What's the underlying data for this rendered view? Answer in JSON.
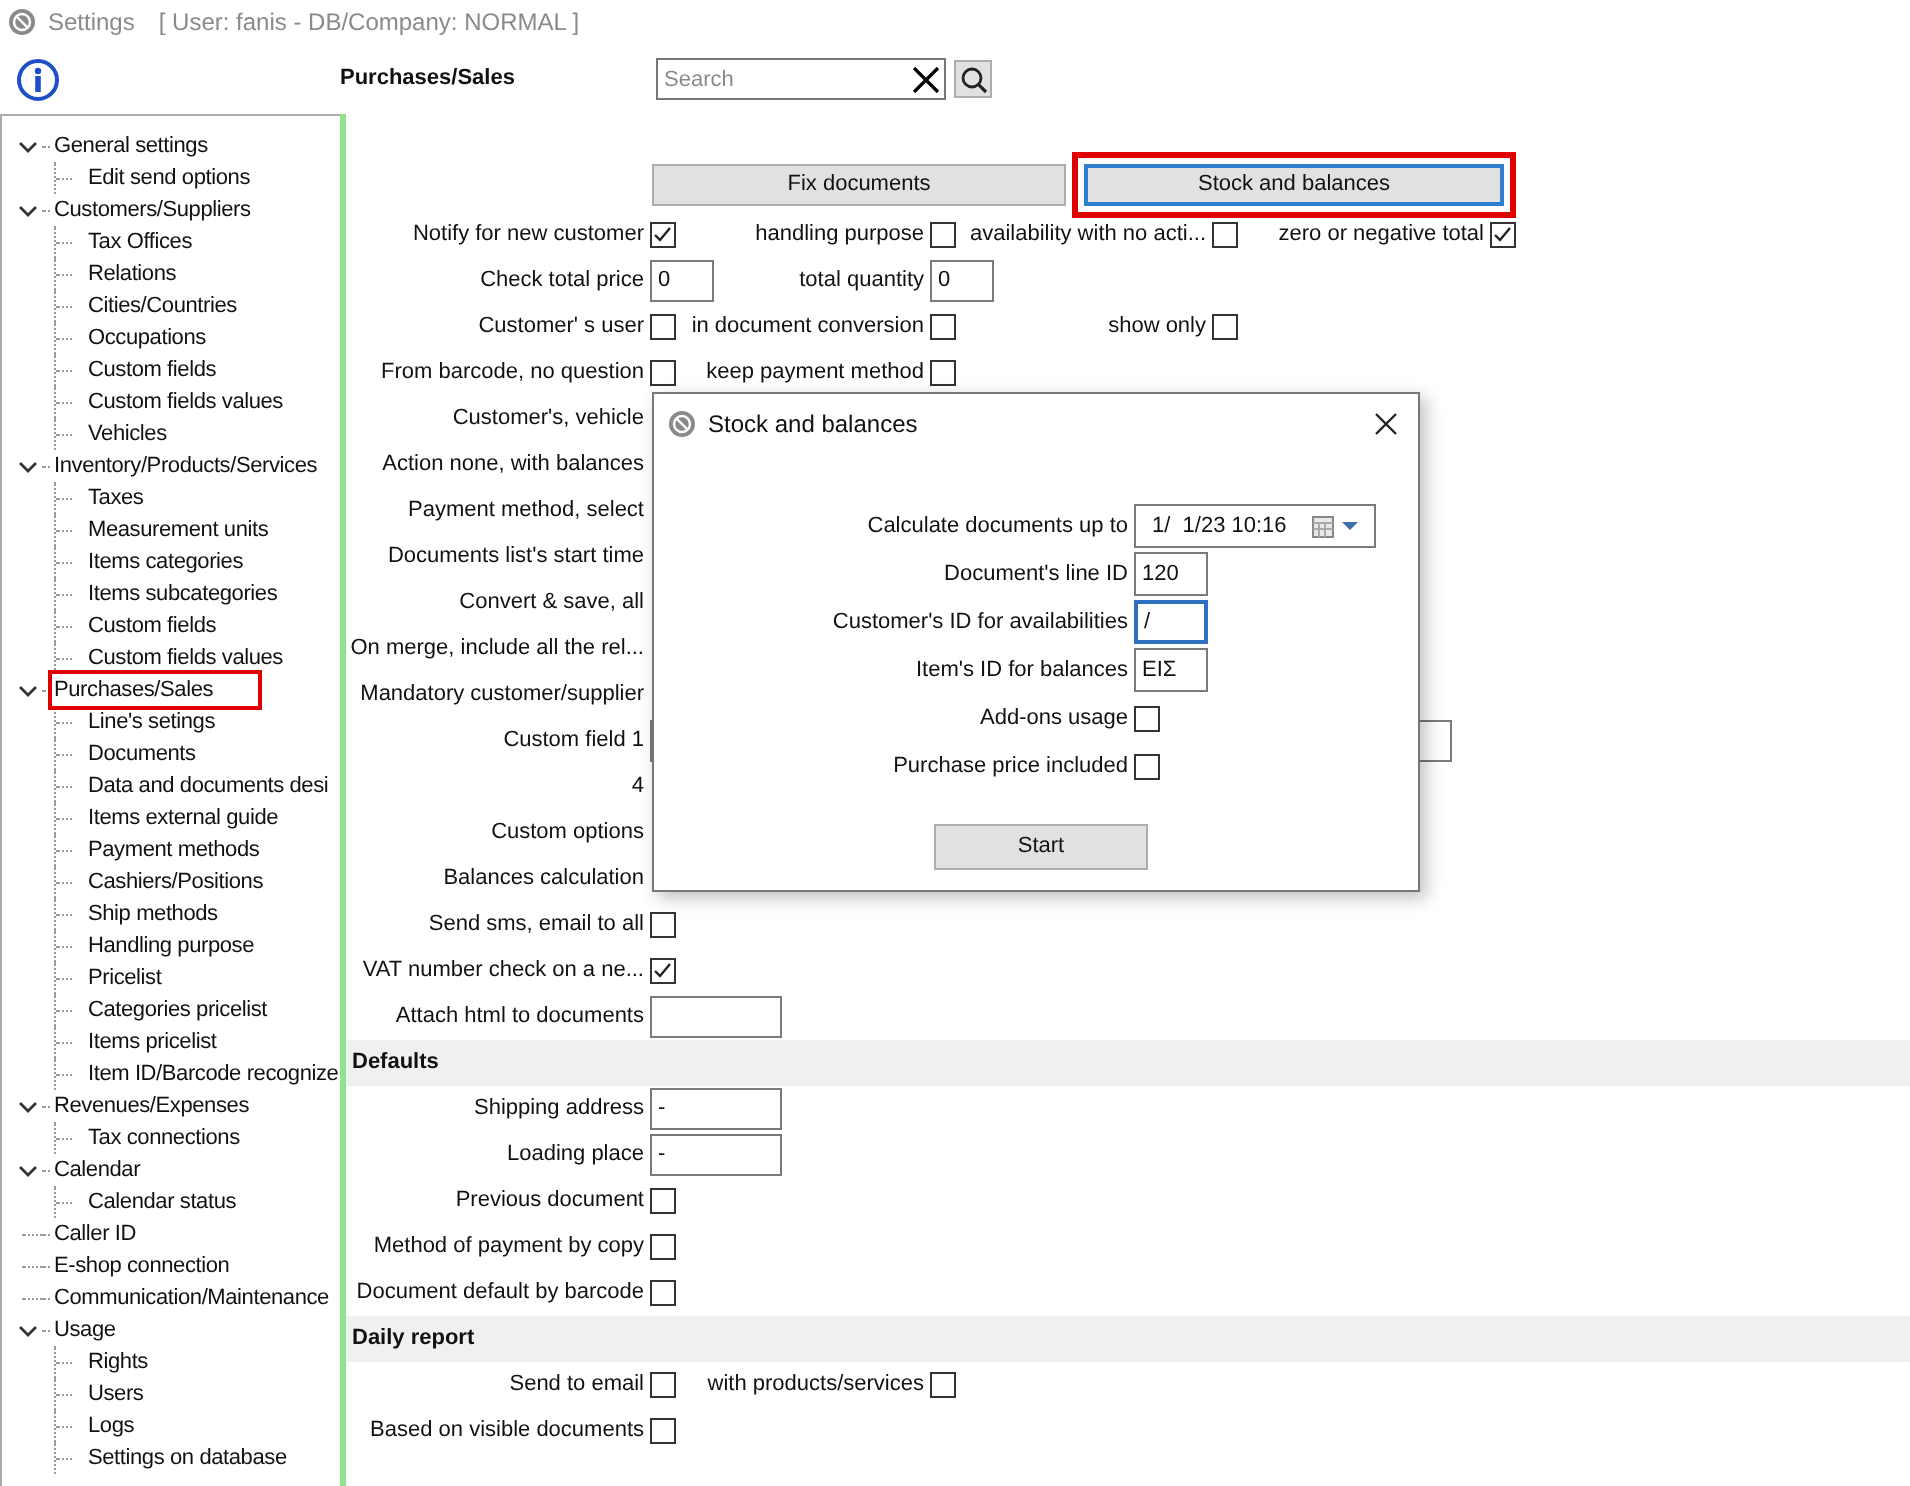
{
  "window": {
    "title": "Settings",
    "context": "[ User: fanis - DB/Company: NORMAL ]"
  },
  "header": {
    "title": "Purchases/Sales",
    "search": {
      "placeholder": "Search"
    }
  },
  "tree": [
    {
      "label": "General settings",
      "expanded": true,
      "highlighted": false,
      "children": [
        {
          "label": "Edit send options",
          "highlighted": false
        }
      ]
    },
    {
      "label": "Customers/Suppliers",
      "expanded": true,
      "highlighted": false,
      "children": [
        {
          "label": "Tax Offices",
          "highlighted": false
        },
        {
          "label": "Relations",
          "highlighted": false
        },
        {
          "label": "Cities/Countries",
          "highlighted": false
        },
        {
          "label": "Occupations",
          "highlighted": false
        },
        {
          "label": "Custom fields",
          "highlighted": false
        },
        {
          "label": "Custom fields values",
          "highlighted": false
        },
        {
          "label": "Vehicles",
          "highlighted": false
        }
      ]
    },
    {
      "label": "Inventory/Products/Services",
      "expanded": true,
      "highlighted": false,
      "children": [
        {
          "label": "Taxes",
          "highlighted": false
        },
        {
          "label": "Measurement units",
          "highlighted": false
        },
        {
          "label": "Items categories",
          "highlighted": false
        },
        {
          "label": "Items subcategories",
          "highlighted": false
        },
        {
          "label": "Custom fields",
          "highlighted": false
        },
        {
          "label": "Custom fields values",
          "highlighted": false
        }
      ]
    },
    {
      "label": "Purchases/Sales",
      "expanded": true,
      "highlighted": true,
      "children": [
        {
          "label": "Line's setings",
          "highlighted": false
        },
        {
          "label": "Documents",
          "highlighted": false
        },
        {
          "label": "Data and documents desi",
          "highlighted": false
        },
        {
          "label": "Items external guide",
          "highlighted": false
        },
        {
          "label": "Payment methods",
          "highlighted": false
        },
        {
          "label": "Cashiers/Positions",
          "highlighted": false
        },
        {
          "label": "Ship methods",
          "highlighted": false
        },
        {
          "label": "Handling purpose",
          "highlighted": false
        },
        {
          "label": "Pricelist",
          "highlighted": false
        },
        {
          "label": "Categories pricelist",
          "highlighted": false
        },
        {
          "label": "Items pricelist",
          "highlighted": false
        },
        {
          "label": "Item ID/Barcode recognize",
          "highlighted": false
        }
      ]
    },
    {
      "label": "Revenues/Expenses",
      "expanded": true,
      "highlighted": false,
      "children": [
        {
          "label": "Tax connections",
          "highlighted": false
        }
      ]
    },
    {
      "label": "Calendar",
      "expanded": true,
      "highlighted": false,
      "children": [
        {
          "label": "Calendar status",
          "highlighted": false
        }
      ]
    },
    {
      "label": "Caller ID",
      "highlighted": false
    },
    {
      "label": "E-shop connection",
      "highlighted": false
    },
    {
      "label": "Communication/Maintenance",
      "highlighted": false
    },
    {
      "label": "Usage",
      "expanded": true,
      "highlighted": false,
      "children": [
        {
          "label": "Rights",
          "highlighted": false
        },
        {
          "label": "Users",
          "highlighted": false
        },
        {
          "label": "Logs",
          "highlighted": false
        },
        {
          "label": "Settings on database",
          "highlighted": false
        }
      ]
    }
  ],
  "actions": [
    {
      "label": "Fix documents",
      "focused": false,
      "highlighted": false
    },
    {
      "label": "Stock and balances",
      "focused": true,
      "highlighted": true
    }
  ],
  "form": [
    {
      "kind": "row",
      "items": [
        {
          "label": "Notify for new customer",
          "kind": "checkbox",
          "checked": true
        },
        {
          "label": "handling purpose",
          "kind": "checkbox",
          "checked": false
        },
        {
          "label": "availability with no acti...",
          "kind": "checkbox",
          "checked": false
        },
        {
          "label": "zero or negative total",
          "kind": "checkbox",
          "checked": true
        }
      ]
    },
    {
      "kind": "row",
      "items": [
        {
          "label": "Check total price",
          "kind": "number",
          "value": "0"
        },
        {
          "label": "total quantity",
          "kind": "number",
          "value": "0"
        }
      ]
    },
    {
      "kind": "row",
      "items": [
        {
          "label": "Customer' s user",
          "kind": "checkbox",
          "checked": false
        },
        {
          "label": "in document conversion",
          "kind": "checkbox",
          "checked": false
        },
        {
          "label": "show only",
          "kind": "checkbox",
          "checked": false
        }
      ]
    },
    {
      "kind": "row",
      "items": [
        {
          "label": "From barcode, no question",
          "kind": "checkbox",
          "checked": false
        },
        {
          "label": "keep payment method",
          "kind": "checkbox",
          "checked": false
        }
      ]
    },
    {
      "kind": "row",
      "items": [
        {
          "label": "Customer's, vehicle",
          "kind": "label"
        }
      ]
    },
    {
      "kind": "row",
      "items": [
        {
          "label": "Action none, with balances",
          "kind": "label"
        }
      ]
    },
    {
      "kind": "row",
      "items": [
        {
          "label": "Payment method, select",
          "kind": "label"
        }
      ]
    },
    {
      "kind": "row",
      "items": [
        {
          "label": "Documents list's start time",
          "kind": "label"
        }
      ]
    },
    {
      "kind": "row",
      "items": [
        {
          "label": "Convert & save, all",
          "kind": "label"
        }
      ]
    },
    {
      "kind": "row",
      "items": [
        {
          "label": "On merge, include all the rel...",
          "kind": "label"
        }
      ]
    },
    {
      "kind": "row",
      "items": [
        {
          "label": "Mandatory customer/supplier",
          "kind": "label"
        }
      ]
    },
    {
      "kind": "row",
      "items": [
        {
          "label": "Custom field 1",
          "kind": "long"
        }
      ]
    },
    {
      "kind": "row",
      "items": [
        {
          "label": "4",
          "kind": "label"
        }
      ]
    },
    {
      "kind": "row",
      "items": [
        {
          "label": "Custom options",
          "kind": "label"
        }
      ]
    },
    {
      "kind": "row",
      "items": [
        {
          "label": "Balances calculation",
          "kind": "label"
        }
      ]
    },
    {
      "kind": "row",
      "items": [
        {
          "label": "Send sms, email to all",
          "kind": "checkbox",
          "checked": false
        }
      ]
    },
    {
      "kind": "row",
      "items": [
        {
          "label": "VAT number check on a ne...",
          "kind": "checkbox",
          "checked": true
        }
      ]
    },
    {
      "kind": "row",
      "items": [
        {
          "label": "Attach html to documents",
          "kind": "text"
        }
      ]
    },
    {
      "kind": "section",
      "title": "Defaults"
    },
    {
      "kind": "row",
      "items": [
        {
          "label": "Shipping address",
          "kind": "text",
          "value": "-"
        }
      ]
    },
    {
      "kind": "row",
      "items": [
        {
          "label": "Loading place",
          "kind": "text",
          "value": "-"
        }
      ]
    },
    {
      "kind": "row",
      "items": [
        {
          "label": "Previous document",
          "kind": "checkbox",
          "checked": false
        }
      ]
    },
    {
      "kind": "row",
      "items": [
        {
          "label": "Method of payment by copy",
          "kind": "checkbox",
          "checked": false
        }
      ]
    },
    {
      "kind": "row",
      "items": [
        {
          "label": "Document default by barcode",
          "kind": "checkbox",
          "checked": false
        }
      ]
    },
    {
      "kind": "section",
      "title": "Daily report"
    },
    {
      "kind": "row",
      "items": [
        {
          "label": "Send to email",
          "kind": "checkbox",
          "checked": false
        },
        {
          "label": "with products/services",
          "kind": "checkbox",
          "checked": false
        }
      ]
    },
    {
      "kind": "row",
      "items": [
        {
          "label": "Based on visible documents",
          "kind": "checkbox",
          "checked": false
        }
      ]
    }
  ],
  "dialog": {
    "title": "Stock and balances",
    "fields": [
      {
        "label": "Calculate documents up to",
        "kind": "date",
        "value": "1/  1/23 10:16"
      },
      {
        "label": "Document's line ID",
        "kind": "field",
        "value": "120",
        "focused": false
      },
      {
        "label": "Customer's ID for availabilities",
        "kind": "field",
        "value": "/",
        "focused": true
      },
      {
        "label": "Item's ID for balances",
        "kind": "field",
        "value": "ΕΙΣ",
        "focused": false
      },
      {
        "label": "Add-ons usage",
        "kind": "checkbox",
        "checked": false
      },
      {
        "label": "Purchase price included",
        "kind": "checkbox",
        "checked": false
      }
    ],
    "button": "Start"
  }
}
